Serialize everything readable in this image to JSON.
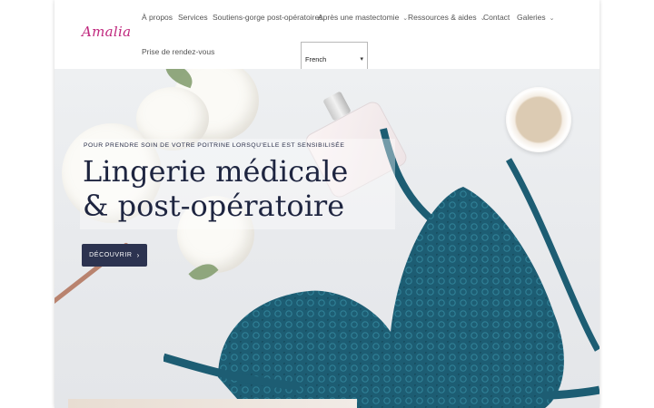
{
  "header": {
    "logo": "Amalia",
    "nav": [
      {
        "label": "À propos",
        "has_dropdown": false
      },
      {
        "label": "Services",
        "has_dropdown": false
      },
      {
        "label": "Soutiens-gorge post-opératoires",
        "has_dropdown": false
      },
      {
        "label": "Après une mastectomie",
        "has_dropdown": true
      },
      {
        "label": "Ressources & aides",
        "has_dropdown": true
      },
      {
        "label": "Contact",
        "has_dropdown": false
      },
      {
        "label": "Galeries",
        "has_dropdown": true
      },
      {
        "label": "Prise de rendez-vous",
        "has_dropdown": false
      }
    ],
    "language_select": {
      "value": "French"
    }
  },
  "hero": {
    "kicker": "POUR PRENDRE SOIN DE VOTRE POITRINE LORSQU'ELLE EST SENSIBILISÉE",
    "title_line1": "Lingerie médicale",
    "title_line2": "& post-opératoire",
    "button_label": "DÉCOUVRIR",
    "button_arrow": "›"
  },
  "icons": {
    "chevron": "chevron-down-icon",
    "button_arrow": "arrow-right-icon"
  },
  "colors": {
    "brand": "#c0287e",
    "nav_text": "#555555",
    "title": "#1e2540",
    "button_bg": "#2c3350",
    "lace": "#1d5d73"
  }
}
